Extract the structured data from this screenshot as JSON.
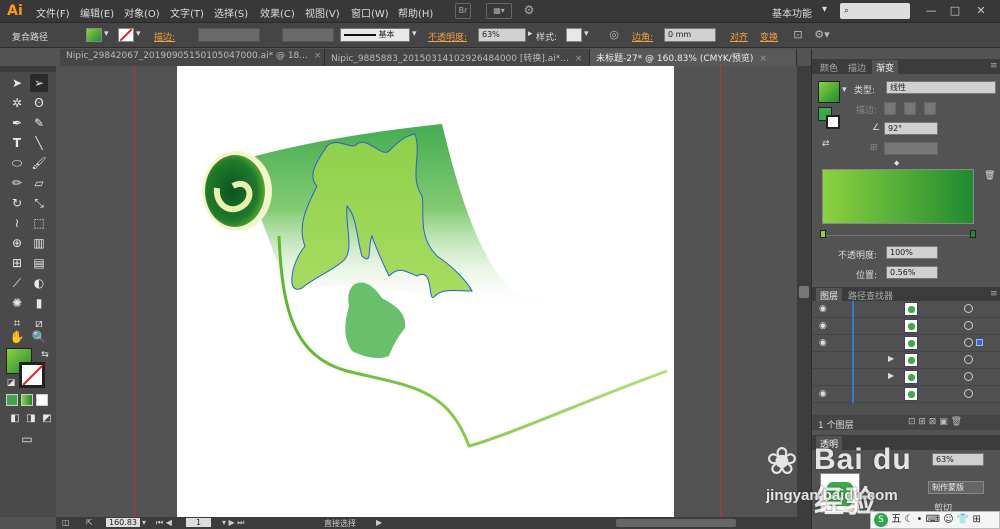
{
  "menubar": {
    "logo": "Ai",
    "items": [
      "文件(F)",
      "编辑(E)",
      "对象(O)",
      "文字(T)",
      "选择(S)",
      "效果(C)",
      "视图(V)",
      "窗口(W)",
      "帮助(H)"
    ],
    "bridge_label": "Br",
    "workspace": "基本功能",
    "window_buttons": [
      "—",
      "□",
      "✕"
    ]
  },
  "controlbar": {
    "object_type": "复合路径",
    "stroke_label": "描边:",
    "brush_label": "基本",
    "opacity_label": "不透明度:",
    "opacity_value": "63%",
    "style_label": "样式:",
    "corner_label": "边角:",
    "corner_value": "0 mm",
    "align_label": "对齐",
    "transform_label": "变换"
  },
  "tabs": [
    {
      "label": "Nipic_29842067_20190905150105047000.ai* @ 18...",
      "active": false
    },
    {
      "label": "Nipic_9885883_20150314102926484000 [转换].ai*...",
      "active": false
    },
    {
      "label": "未标题-27* @ 160.83% (CMYK/预览)",
      "active": true
    }
  ],
  "panel": {
    "top_tabs": [
      "颜色",
      "描边",
      "渐变"
    ],
    "type_label": "类型:",
    "type_value": "线性",
    "stroke_label": "描边:",
    "angle_value": "92°",
    "opacity_label": "不透明度:",
    "opacity_value": "100%",
    "position_label": "位置:",
    "position_value": "0.56%",
    "layer_tabs": [
      "图层",
      "路径查找器"
    ],
    "layer_count": "1 个图层",
    "bottom_tab": "透明",
    "bottom_opacity": "63%",
    "make_mask": "制作蒙版",
    "bottom_partial": "剪切"
  },
  "status": {
    "zoom": "160.83",
    "page": "1",
    "tool": "直接选择"
  },
  "watermark": {
    "brand": "Bai du 经验",
    "url": "jingyan.baidu.com"
  },
  "ime": {
    "label": "五"
  },
  "colors": {
    "gradient_start": "#8bd33f",
    "gradient_end": "#1f8a30",
    "selection_blue": "#2e5bd8",
    "menu_bg": "#383838"
  }
}
